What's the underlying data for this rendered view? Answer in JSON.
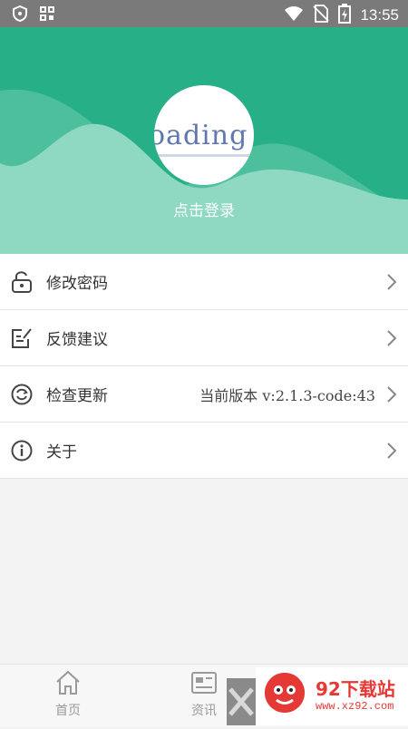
{
  "status_bar": {
    "time": "13:55"
  },
  "header": {
    "avatar_text": "oading",
    "login_label": "点击登录"
  },
  "menu": [
    {
      "icon": "unlock-icon",
      "label": "修改密码",
      "value": ""
    },
    {
      "icon": "edit-note-icon",
      "label": "反馈建议",
      "value": ""
    },
    {
      "icon": "refresh-icon",
      "label": "检查更新",
      "value": "当前版本  v:2.1.3-code:43"
    },
    {
      "icon": "info-icon",
      "label": "关于",
      "value": ""
    }
  ],
  "nav": {
    "tabs": [
      {
        "icon": "home-icon",
        "label": "首页"
      },
      {
        "icon": "news-icon",
        "label": "资讯"
      }
    ]
  },
  "watermark": {
    "brand": "92下载站",
    "url": "www.xz92.com"
  },
  "colors": {
    "primary": "#27b088",
    "wave_light": "#8fd8c2",
    "watermark": "#e53935"
  }
}
